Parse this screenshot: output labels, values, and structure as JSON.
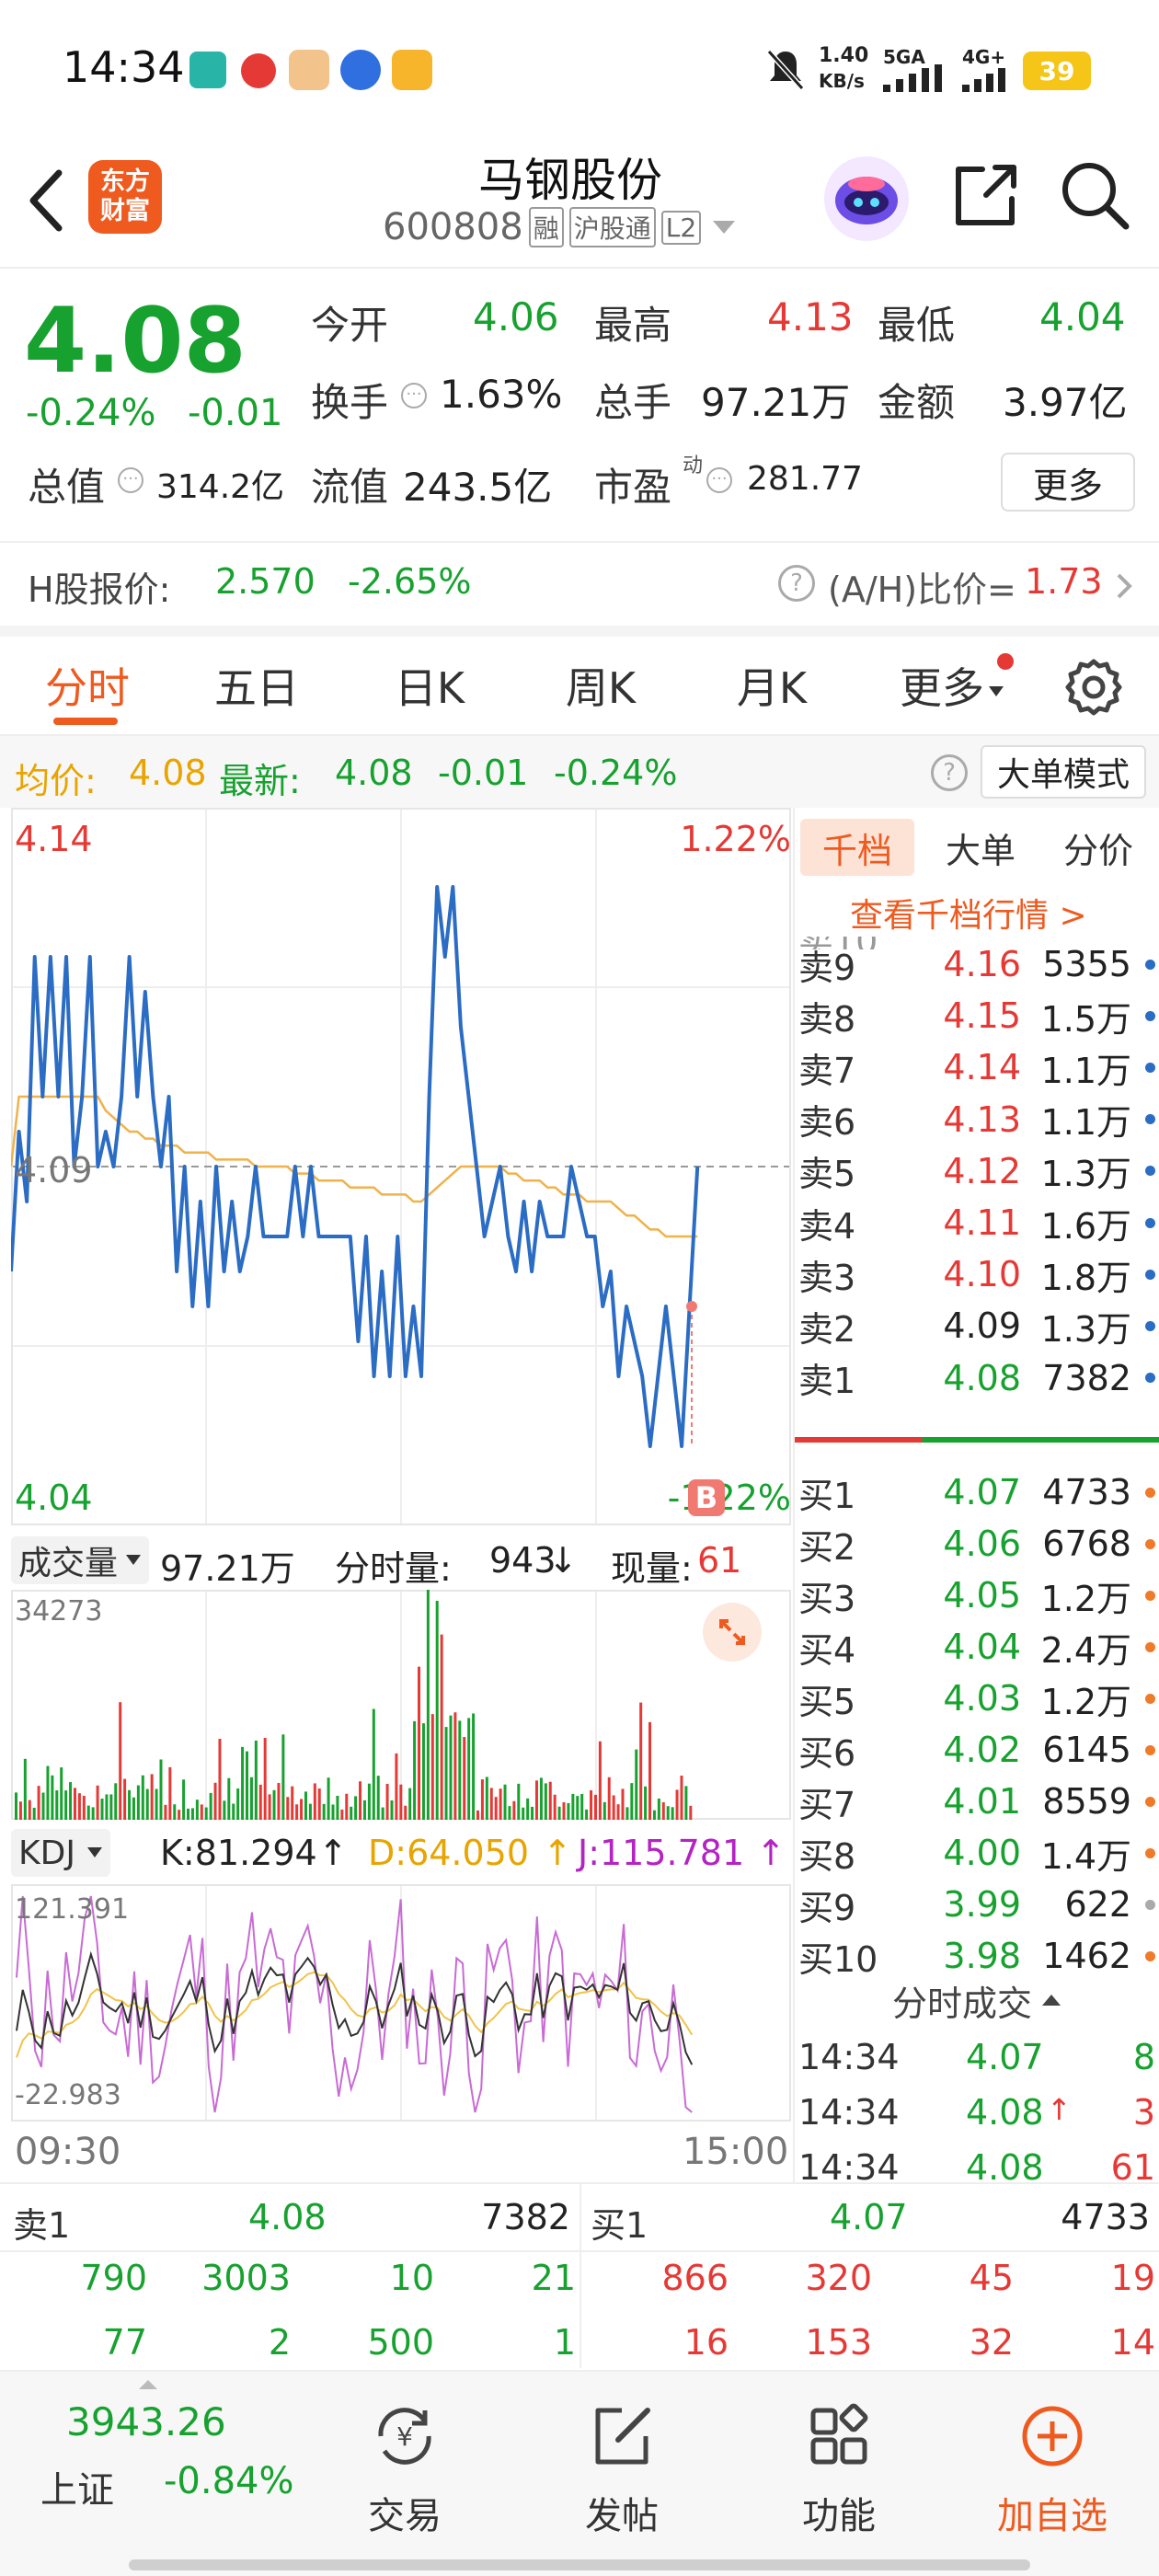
{
  "status_bar": {
    "time": "14:34",
    "speed_value": "1.40",
    "speed_unit": "KB/s",
    "net1": "5GA",
    "net2": "4G+",
    "battery": "39"
  },
  "header": {
    "logo_line1": "东方",
    "logo_line2": "财富",
    "stock_name": "马钢股份",
    "stock_code": "600808",
    "tag_rong": "融",
    "tag_hgt": "沪股通",
    "tag_l2": "L2"
  },
  "quote": {
    "price": "4.08",
    "change_pct": "-0.24%",
    "change": "-0.01",
    "open_label": "今开",
    "open": "4.06",
    "high_label": "最高",
    "high": "4.13",
    "low_label": "最低",
    "low": "4.04",
    "turnover_label": "换手",
    "turnover": "1.63%",
    "volume_label": "总手",
    "volume": "97.21万",
    "amount_label": "金额",
    "amount": "3.97亿",
    "mktcap_label": "总值",
    "mktcap": "314.2亿",
    "float_label": "流值",
    "float": "243.5亿",
    "pe_label": "市盈",
    "pe_sup": "动",
    "pe": "281.77",
    "more_button": "更多"
  },
  "h_share": {
    "label": "H股报价:",
    "price": "2.570",
    "change": "-2.65%",
    "ah_label": "(A/H)比价=",
    "ah_value": "1.73"
  },
  "tabs": [
    {
      "label": "分时",
      "active": true
    },
    {
      "label": "五日",
      "active": false
    },
    {
      "label": "日K",
      "active": false
    },
    {
      "label": "周K",
      "active": false
    },
    {
      "label": "月K",
      "active": false
    },
    {
      "label": "更多",
      "active": false
    }
  ],
  "info_bar": {
    "avg_label": "均价:",
    "avg": "4.08",
    "latest_label": "最新:",
    "latest": "4.08",
    "change": "-0.01",
    "change_pct": "-0.24%",
    "big_order_button": "大单模式"
  },
  "chart": {
    "price_top": "4.14",
    "pct_top": "1.22%",
    "price_mid": "4.09",
    "price_bottom": "4.04",
    "pct_bottom": "-1.22%",
    "marker": "B",
    "watermark": "东方财富",
    "time_start": "09:30",
    "time_end": "15:00"
  },
  "chart_data": {
    "type": "line",
    "title": "",
    "ylim": [
      4.04,
      4.14
    ],
    "x_range": [
      "09:30",
      "15:00"
    ],
    "series": [
      {
        "values": [
          4.075,
          4.095,
          4.085,
          4.12,
          4.1,
          4.12,
          4.1,
          4.12,
          4.09,
          4.1,
          4.12,
          4.09,
          4.095,
          4.09,
          4.1,
          4.12,
          4.1,
          4.115,
          4.1,
          4.09,
          4.1,
          4.075,
          4.09,
          4.07,
          4.085,
          4.07,
          4.09,
          4.075,
          4.085,
          4.075,
          4.08,
          4.09,
          4.08,
          4.08,
          4.08,
          4.08,
          4.09,
          4.08,
          4.09,
          4.08,
          4.08,
          4.08,
          4.08,
          4.08,
          4.065,
          4.08,
          4.06,
          4.075,
          4.06,
          4.08,
          4.06,
          4.07,
          4.06,
          4.1,
          4.13,
          4.12,
          4.13,
          4.11,
          4.1,
          4.09,
          4.08,
          4.085,
          4.09,
          4.08,
          4.075,
          4.085,
          4.075,
          4.085,
          4.08,
          4.08,
          4.08,
          4.09,
          4.085,
          4.08,
          4.08,
          4.07,
          4.075,
          4.06,
          4.07,
          4.065,
          4.06,
          4.05,
          4.06,
          4.07,
          4.06,
          4.05,
          4.07,
          4.09
        ]
      },
      {
        "values": [
          4.09,
          4.1,
          4.1,
          4.1,
          4.1,
          4.1,
          4.1,
          4.1,
          4.1,
          4.1,
          4.1,
          4.1,
          4.098,
          4.097,
          4.096,
          4.095,
          4.095,
          4.094,
          4.094,
          4.093,
          4.093,
          4.093,
          4.092,
          4.092,
          4.092,
          4.092,
          4.091,
          4.091,
          4.091,
          4.091,
          4.091,
          4.09,
          4.09,
          4.09,
          4.09,
          4.09,
          4.089,
          4.089,
          4.089,
          4.088,
          4.088,
          4.088,
          4.088,
          4.087,
          4.087,
          4.087,
          4.087,
          4.086,
          4.086,
          4.086,
          4.086,
          4.085,
          4.085,
          4.086,
          4.087,
          4.088,
          4.089,
          4.09,
          4.09,
          4.09,
          4.09,
          4.09,
          4.09,
          4.089,
          4.089,
          4.088,
          4.088,
          4.088,
          4.087,
          4.087,
          4.086,
          4.086,
          4.086,
          4.085,
          4.085,
          4.085,
          4.085,
          4.084,
          4.083,
          4.083,
          4.082,
          4.081,
          4.081,
          4.08,
          4.08,
          4.08,
          4.08,
          4.08
        ]
      }
    ]
  },
  "volume_bar": {
    "label": "成交量",
    "total": "97.21万",
    "tick_label": "分时量:",
    "tick_value": "943",
    "now_label": "现量:",
    "now_value": "61",
    "max": "34273"
  },
  "kdj": {
    "label": "KDJ",
    "k": "K:81.294",
    "d": "D:64.050",
    "j": "J:115.781",
    "max": "121.391",
    "min": "-22.983"
  },
  "order_book": {
    "tab1": "千档",
    "tab2": "大单",
    "tab3": "分价",
    "view_link": "查看千档行情 >",
    "asks": [
      {
        "label": "卖9",
        "price": "4.16",
        "vol": "5355"
      },
      {
        "label": "卖8",
        "price": "4.15",
        "vol": "1.5万"
      },
      {
        "label": "卖7",
        "price": "4.14",
        "vol": "1.1万"
      },
      {
        "label": "卖6",
        "price": "4.13",
        "vol": "1.1万"
      },
      {
        "label": "卖5",
        "price": "4.12",
        "vol": "1.3万"
      },
      {
        "label": "卖4",
        "price": "4.11",
        "vol": "1.6万"
      },
      {
        "label": "卖3",
        "price": "4.10",
        "vol": "1.8万"
      },
      {
        "label": "卖2",
        "price": "4.09",
        "vol": "1.3万"
      },
      {
        "label": "卖1",
        "price": "4.08",
        "vol": "7382"
      }
    ],
    "bids": [
      {
        "label": "买1",
        "price": "4.07",
        "vol": "4733"
      },
      {
        "label": "买2",
        "price": "4.06",
        "vol": "6768"
      },
      {
        "label": "买3",
        "price": "4.05",
        "vol": "1.2万"
      },
      {
        "label": "买4",
        "price": "4.04",
        "vol": "2.4万"
      },
      {
        "label": "买5",
        "price": "4.03",
        "vol": "1.2万"
      },
      {
        "label": "买6",
        "price": "4.02",
        "vol": "6145"
      },
      {
        "label": "买7",
        "price": "4.01",
        "vol": "8559"
      },
      {
        "label": "买8",
        "price": "4.00",
        "vol": "1.4万"
      },
      {
        "label": "买9",
        "price": "3.99",
        "vol": "622"
      },
      {
        "label": "买10",
        "price": "3.98",
        "vol": "1462"
      }
    ],
    "trades_title": "分时成交",
    "trades": [
      {
        "time": "14:34",
        "price": "4.07",
        "arrow": "",
        "vol": "8"
      },
      {
        "time": "14:34",
        "price": "4.08",
        "arrow": "↑",
        "vol": "3"
      },
      {
        "time": "14:34",
        "price": "4.08",
        "arrow": "",
        "vol": "61"
      }
    ]
  },
  "queue": {
    "sell_label": "卖1",
    "sell_price": "4.08",
    "sell_vol": "7382",
    "buy_label": "买1",
    "buy_price": "4.07",
    "buy_vol": "4733",
    "sell_row1": [
      "790",
      "3003",
      "10",
      "21"
    ],
    "sell_row2": [
      "77",
      "2",
      "500",
      "1"
    ],
    "buy_row1": [
      "866",
      "320",
      "45",
      "19"
    ],
    "buy_row2": [
      "16",
      "153",
      "32",
      "14"
    ]
  },
  "bottom_nav": {
    "index_value": "3943.26",
    "index_name": "上证",
    "index_change": "-0.84%",
    "trade": "交易",
    "post": "发帖",
    "functions": "功能",
    "add_watch": "加自选"
  }
}
